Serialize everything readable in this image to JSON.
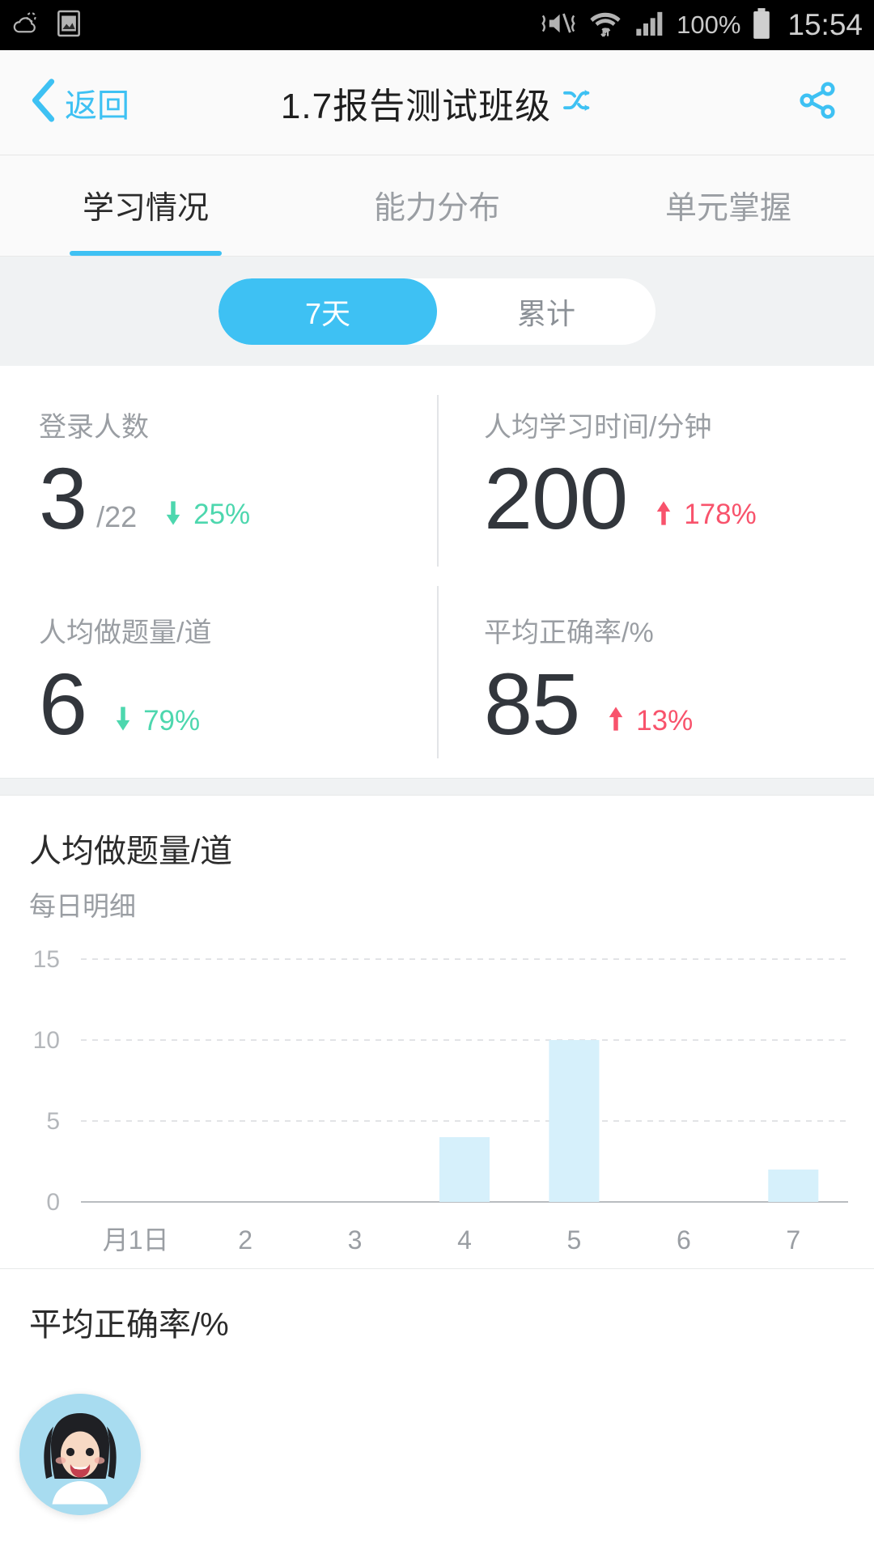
{
  "statusbar": {
    "time": "15:54",
    "battery_pct": "100%",
    "icons": [
      "weather-icon",
      "screenshot-icon",
      "vibrate-mute-icon",
      "wifi-icon",
      "signal-icon",
      "battery-icon"
    ]
  },
  "navbar": {
    "back_label": "返回",
    "back_icon": "chevron-left-icon",
    "title": "1.7报告测试班级",
    "switch_icon": "shuffle-switch-icon",
    "share_icon": "share-icon"
  },
  "tabs": [
    {
      "label": "学习情况",
      "active": true
    },
    {
      "label": "能力分布",
      "active": false
    },
    {
      "label": "单元掌握",
      "active": false
    }
  ],
  "segment": {
    "options": [
      {
        "label": "7天",
        "active": true
      },
      {
        "label": "累计",
        "active": false
      }
    ]
  },
  "stats": [
    {
      "label": "登录人数",
      "value": "3",
      "total": "/22",
      "delta_pct": "25%",
      "delta_dir": "down",
      "delta_color": "#4dd7ae"
    },
    {
      "label": "人均学习时间/分钟",
      "value": "200",
      "total": "",
      "delta_pct": "178%",
      "delta_dir": "up",
      "delta_color": "#f8536c"
    },
    {
      "label": "人均做题量/道",
      "value": "6",
      "total": "",
      "delta_pct": "79%",
      "delta_dir": "down",
      "delta_color": "#4dd7ae"
    },
    {
      "label": "平均正确率/%",
      "value": "85",
      "total": "",
      "delta_pct": "13%",
      "delta_dir": "up",
      "delta_color": "#f8536c"
    }
  ],
  "chart_section": {
    "title": "人均做题量/道",
    "subtitle": "每日明细"
  },
  "chart_section2": {
    "title": "平均正确率/%"
  },
  "avatar": {
    "name": "user-avatar",
    "bg": "#a8dcf0"
  },
  "chart_data": {
    "type": "bar",
    "title": "人均做题量/道",
    "subtitle": "每日明细",
    "categories": [
      "月1日",
      "2",
      "3",
      "4",
      "5",
      "6",
      "7"
    ],
    "values": [
      0,
      0,
      0,
      4,
      10,
      0,
      2
    ],
    "xlabel": "",
    "ylabel": "",
    "ylim": [
      0,
      15
    ],
    "yticks": [
      0,
      5,
      10,
      15
    ],
    "grid": true,
    "bar_color": "#d6f0fb",
    "legend": null
  }
}
